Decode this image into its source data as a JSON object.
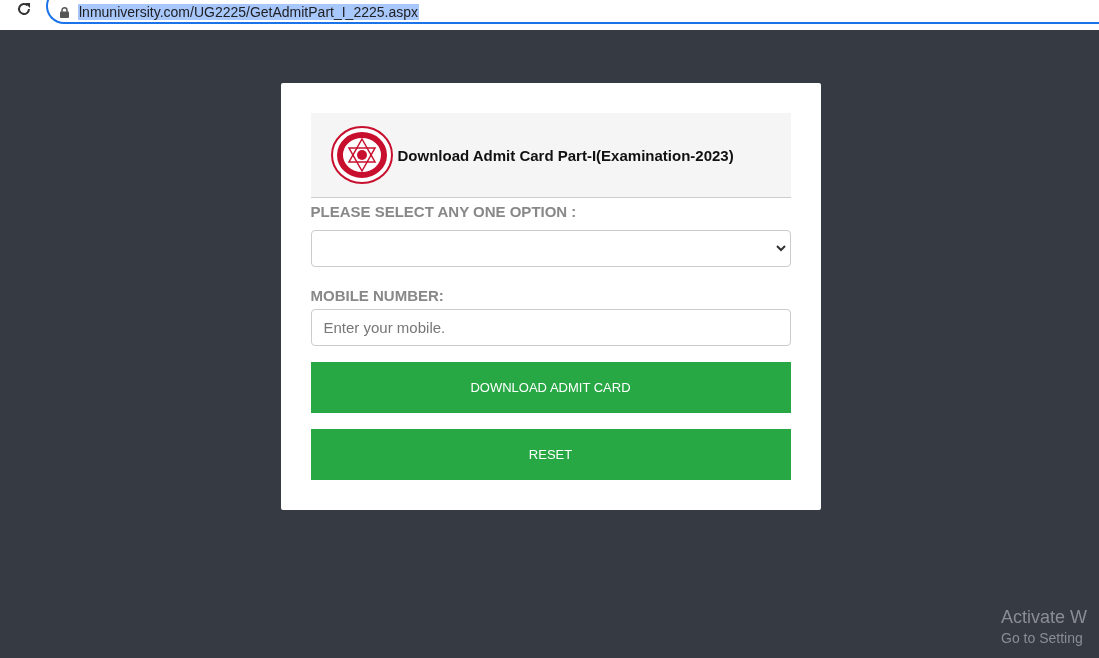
{
  "address_bar": {
    "url": "lnmuniversity.com/UG2225/GetAdmitPart_I_2225.aspx",
    "selected": true
  },
  "form": {
    "title": "Download Admit Card Part-I(Examination-2023)",
    "option_label": "PLEASE SELECT ANY ONE OPTION :",
    "mobile_label": "MOBILE NUMBER:",
    "mobile_placeholder": "Enter your mobile.",
    "buttons": [
      "DOWNLOAD ADMIT CARD",
      "RESET"
    ]
  },
  "os_notice": {
    "title": "Activate W",
    "subtitle": "Go to Setting"
  }
}
